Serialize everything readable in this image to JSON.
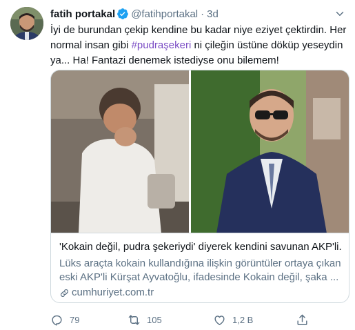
{
  "tweet": {
    "display_name": "fatih portakal",
    "handle": "@fatihportakal",
    "separator": "·",
    "time": "3d",
    "text_line1": "İyi de burundan çekip kendine bu kadar niye eziyet çektirdin. Her",
    "text_line2_pre": "normal insan gibi ",
    "hashtag": "#pudraşekeri",
    "text_line2_post": " ni çileğin üstüne döküp yeseydin",
    "text_line3": "ya...  Ha! Fantazi denemek istediyse onu bilemem!"
  },
  "card": {
    "title": "'Kokain değil, pudra şekeriydi' diyerek kendini savunan AKP'li...",
    "desc_line1": "Lüks araçta kokain kullandığına ilişkin görüntüler ortaya çıkan",
    "desc_line2": "eski AKP'li Kürşat Ayvatoğlu, ifadesinde Kokain değil, şaka ...",
    "domain": "cumhuriyet.com.tr"
  },
  "actions": {
    "reply_count": "79",
    "retweet_count": "105",
    "like_count": "1,2 B"
  },
  "colors": {
    "text": "#0f1419",
    "secondary": "#5b7083",
    "hashtag": "#794bc4",
    "verified": "#1da1f2",
    "border": "#cfd9de"
  },
  "icons": {
    "verified": "verified-badge-icon",
    "caret": "chevron-down-icon",
    "link": "link-icon",
    "reply": "reply-icon",
    "retweet": "retweet-icon",
    "like": "heart-icon",
    "share": "share-icon"
  }
}
